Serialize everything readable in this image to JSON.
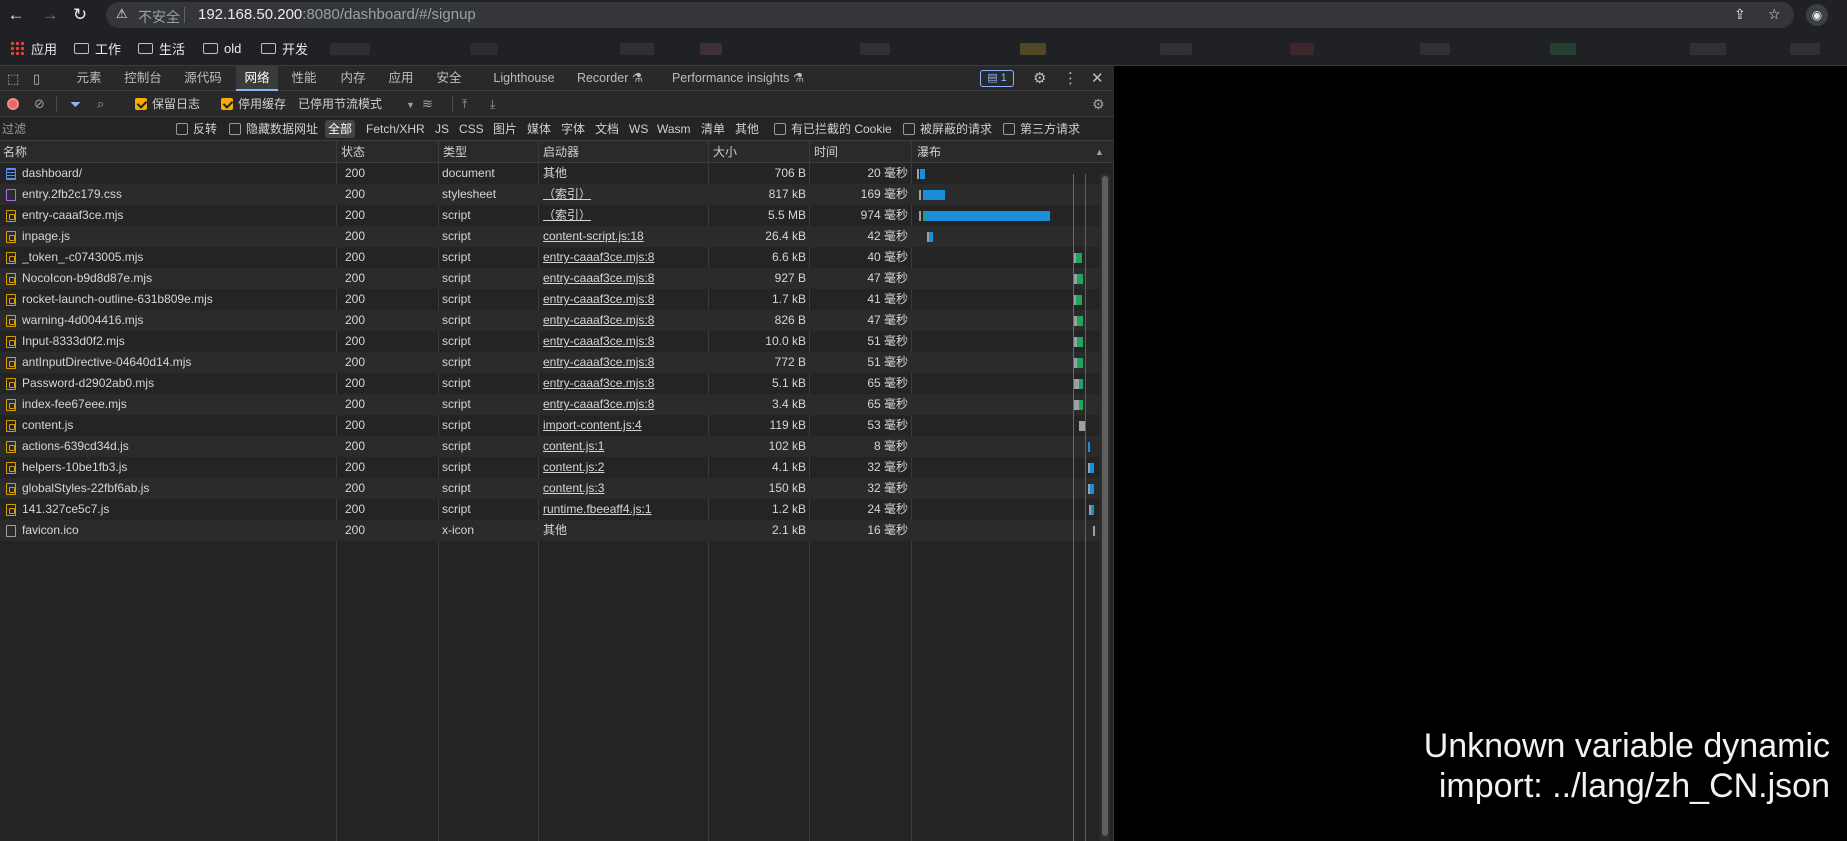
{
  "browser": {
    "insecure_label": "不安全",
    "url_host": "192.168.50.200",
    "url_rest": ":8080/dashboard/#/signup"
  },
  "bookmarks": [
    "应用",
    "工作",
    "生活",
    "old",
    "开发"
  ],
  "devtools": {
    "tabs": [
      "元素",
      "控制台",
      "源代码",
      "网络",
      "性能",
      "内存",
      "应用",
      "安全",
      "Lighthouse",
      "Recorder ⚗",
      "Performance insights ⚗"
    ],
    "active_tab": "网络",
    "issues_count": "1",
    "toolbar": {
      "preserve_log": "保留日志",
      "disable_cache": "停用缓存",
      "throttling": "已停用节流模式"
    },
    "filter": {
      "placeholder": "过滤",
      "invert": "反转",
      "hide_data_urls": "隐藏数据网址",
      "types": [
        "全部",
        "Fetch/XHR",
        "JS",
        "CSS",
        "图片",
        "媒体",
        "字体",
        "文档",
        "WS",
        "Wasm",
        "清单",
        "其他"
      ],
      "blocked_cookies": "有已拦截的 Cookie",
      "blocked_requests": "被屏蔽的请求",
      "third_party": "第三方请求"
    },
    "columns": [
      "名称",
      "状态",
      "类型",
      "启动器",
      "大小",
      "时间",
      "瀑布"
    ],
    "requests": [
      {
        "name": "dashboard/",
        "status": "200",
        "type": "document",
        "initiator": "其他",
        "size": "706 B",
        "time": "20 毫秒"
      },
      {
        "name": "entry.2fb2c179.css",
        "status": "200",
        "type": "stylesheet",
        "initiator": "（索引）",
        "size": "817 kB",
        "time": "169 毫秒"
      },
      {
        "name": "entry-caaaf3ce.mjs",
        "status": "200",
        "type": "script",
        "initiator": "（索引）",
        "size": "5.5 MB",
        "time": "974 毫秒"
      },
      {
        "name": "inpage.js",
        "status": "200",
        "type": "script",
        "initiator": "content-script.js:18",
        "size": "26.4 kB",
        "time": "42 毫秒"
      },
      {
        "name": "_token_-c0743005.mjs",
        "status": "200",
        "type": "script",
        "initiator": "entry-caaaf3ce.mjs:8",
        "size": "6.6 kB",
        "time": "40 毫秒"
      },
      {
        "name": "NocoIcon-b9d8d87e.mjs",
        "status": "200",
        "type": "script",
        "initiator": "entry-caaaf3ce.mjs:8",
        "size": "927 B",
        "time": "47 毫秒"
      },
      {
        "name": "rocket-launch-outline-631b809e.mjs",
        "status": "200",
        "type": "script",
        "initiator": "entry-caaaf3ce.mjs:8",
        "size": "1.7 kB",
        "time": "41 毫秒"
      },
      {
        "name": "warning-4d004416.mjs",
        "status": "200",
        "type": "script",
        "initiator": "entry-caaaf3ce.mjs:8",
        "size": "826 B",
        "time": "47 毫秒"
      },
      {
        "name": "Input-8333d0f2.mjs",
        "status": "200",
        "type": "script",
        "initiator": "entry-caaaf3ce.mjs:8",
        "size": "10.0 kB",
        "time": "51 毫秒"
      },
      {
        "name": "antInputDirective-04640d14.mjs",
        "status": "200",
        "type": "script",
        "initiator": "entry-caaaf3ce.mjs:8",
        "size": "772 B",
        "time": "51 毫秒"
      },
      {
        "name": "Password-d2902ab0.mjs",
        "status": "200",
        "type": "script",
        "initiator": "entry-caaaf3ce.mjs:8",
        "size": "5.1 kB",
        "time": "65 毫秒"
      },
      {
        "name": "index-fee67eee.mjs",
        "status": "200",
        "type": "script",
        "initiator": "entry-caaaf3ce.mjs:8",
        "size": "3.4 kB",
        "time": "65 毫秒"
      },
      {
        "name": "content.js",
        "status": "200",
        "type": "script",
        "initiator": "import-content.js:4",
        "size": "119 kB",
        "time": "53 毫秒"
      },
      {
        "name": "actions-639cd34d.js",
        "status": "200",
        "type": "script",
        "initiator": "content.js:1",
        "size": "102 kB",
        "time": "8 毫秒"
      },
      {
        "name": "helpers-10be1fb3.js",
        "status": "200",
        "type": "script",
        "initiator": "content.js:2",
        "size": "4.1 kB",
        "time": "32 毫秒"
      },
      {
        "name": "globalStyles-22fbf6ab.js",
        "status": "200",
        "type": "script",
        "initiator": "content.js:3",
        "size": "150 kB",
        "time": "32 毫秒"
      },
      {
        "name": "141.327ce5c7.js",
        "status": "200",
        "type": "script",
        "initiator": "runtime.fbeeaff4.js:1",
        "size": "1.2 kB",
        "time": "24 毫秒"
      },
      {
        "name": "favicon.ico",
        "status": "200",
        "type": "x-icon",
        "initiator": "其他",
        "size": "2.1 kB",
        "time": "16 毫秒"
      }
    ]
  },
  "page": {
    "error_line1": "Unknown variable dynamic",
    "error_line2": "import: ../lang/zh_CN.json"
  },
  "colors": {
    "active_tab_underline": "#8ab4f8",
    "checkbox_on": "#f9ab00",
    "waterfall_blue": "#1a8fd9",
    "waterfall_green": "#1fa55a"
  }
}
